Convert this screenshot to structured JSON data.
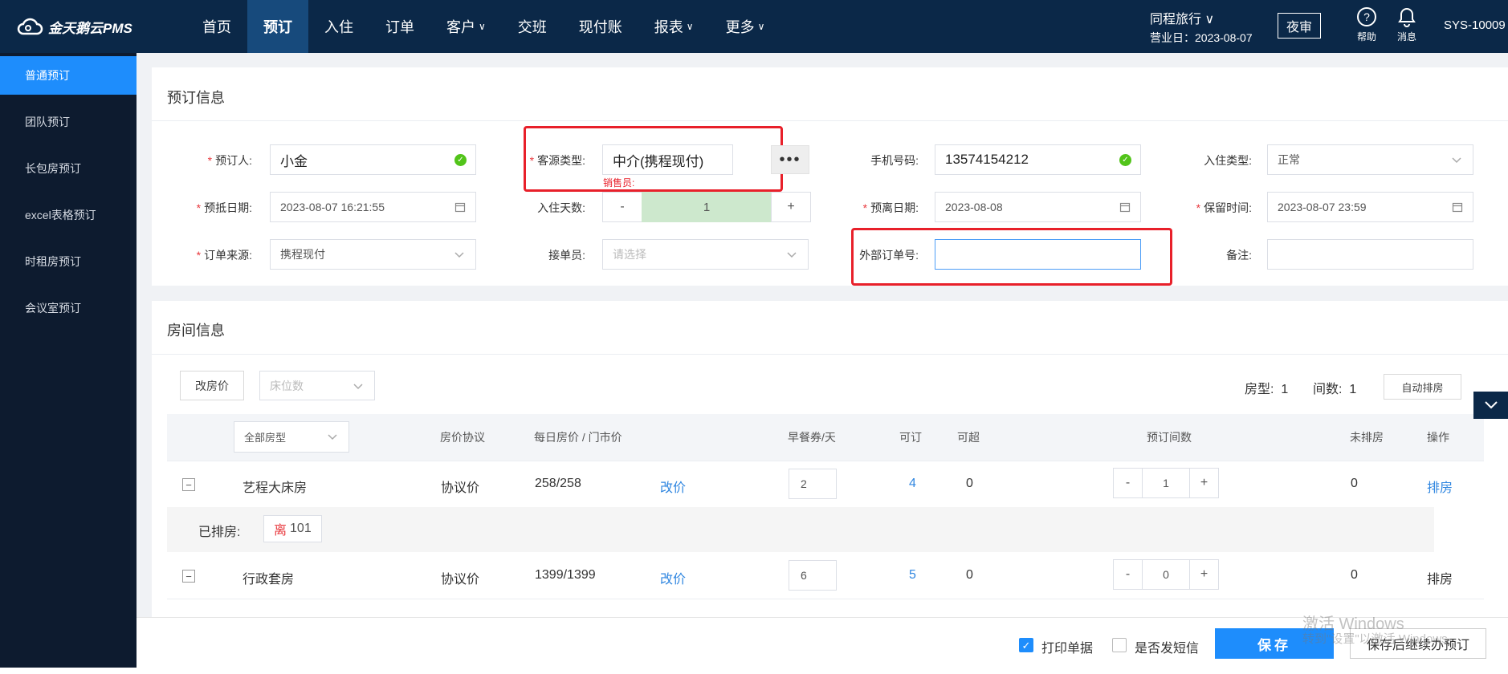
{
  "app": {
    "logo_text": "金天鹅云PMS"
  },
  "nav": [
    {
      "label": "首页",
      "chev": ""
    },
    {
      "label": "预订",
      "chev": ""
    },
    {
      "label": "入住",
      "chev": ""
    },
    {
      "label": "订单",
      "chev": ""
    },
    {
      "label": "客户",
      "chev": "∨"
    },
    {
      "label": "交班",
      "chev": ""
    },
    {
      "label": "现付账",
      "chev": ""
    },
    {
      "label": "报表",
      "chev": "∨"
    },
    {
      "label": "更多",
      "chev": "∨"
    }
  ],
  "header": {
    "hotel": "同程旅行 ∨",
    "business_date": "营业日：2023-08-07",
    "night_audit": "夜审",
    "help": "帮助",
    "messages": "消息",
    "user": "SYS-10009"
  },
  "sidebar": [
    {
      "label": "普通预订"
    },
    {
      "label": "团队预订"
    },
    {
      "label": "长包房预订"
    },
    {
      "label": "excel表格预订"
    },
    {
      "label": "时租房预订"
    },
    {
      "label": "会议室预订"
    }
  ],
  "booking": {
    "title": "预订信息",
    "booker_label": "预订人:",
    "booker": "小金",
    "source_type_label": "客源类型:",
    "source_type": "中介(携程现付)",
    "salesperson_label": "销售员:",
    "phone_label": "手机号码:",
    "phone": "13574154212",
    "checkin_type_label": "入住类型:",
    "checkin_type": "正常",
    "arrival_label": "预抵日期:",
    "arrival": "2023-08-07 16:21:55",
    "nights_label": "入住天数:",
    "nights": "1",
    "departure_label": "预离日期:",
    "departure": "2023-08-08",
    "hold_label": "保留时间:",
    "hold": "2023-08-07 23:59",
    "order_source_label": "订单来源:",
    "order_source": "携程现付",
    "receiver_label": "接单员:",
    "receiver_placeholder": "请选择",
    "external_no_label": "外部订单号:",
    "external_no": "",
    "remark_label": "备注:",
    "remark": ""
  },
  "rooms": {
    "title": "房间信息",
    "change_price_btn": "改房价",
    "bed_count_placeholder": "床位数",
    "room_type_label": "房型:",
    "room_type_count": "1",
    "room_count_label": "间数:",
    "room_count": "1",
    "auto_assign_btn": "自动排房",
    "all_room_types": "全部房型",
    "headers": {
      "agreement": "房价协议",
      "daily_price": "每日房价 / 门市价",
      "breakfast": "早餐券/天",
      "available": "可订",
      "overbook": "可超",
      "booked_rooms": "预订间数",
      "unassigned": "未排房",
      "action": "操作"
    },
    "rows": [
      {
        "name": "艺程大床房",
        "agreement": "协议价",
        "price": "258/258",
        "change": "改价",
        "breakfast": "2",
        "available": "4",
        "overbook": "0",
        "qty": "1",
        "unassigned": "0",
        "action": "排房"
      },
      {
        "name": "行政套房",
        "agreement": "协议价",
        "price": "1399/1399",
        "change": "改价",
        "breakfast": "6",
        "available": "5",
        "overbook": "0",
        "qty": "0",
        "unassigned": "0",
        "action": "排房"
      }
    ],
    "assigned_label": "已排房:",
    "assigned_tag": "离",
    "assigned_room": "101"
  },
  "footer": {
    "print_label": "打印单据",
    "print_checked": true,
    "sms_label": "是否发短信",
    "sms_checked": false,
    "save": "保存",
    "save_continue": "保存后继续办预订",
    "watermark_title": "激活 Windows",
    "watermark_sub": "转到\"设置\"以激活 Windows。"
  },
  "colors": {
    "topbar": "#0b2848",
    "accent": "#1e8dfc",
    "highlight_box": "#e8202a",
    "link": "#2f86e0"
  }
}
